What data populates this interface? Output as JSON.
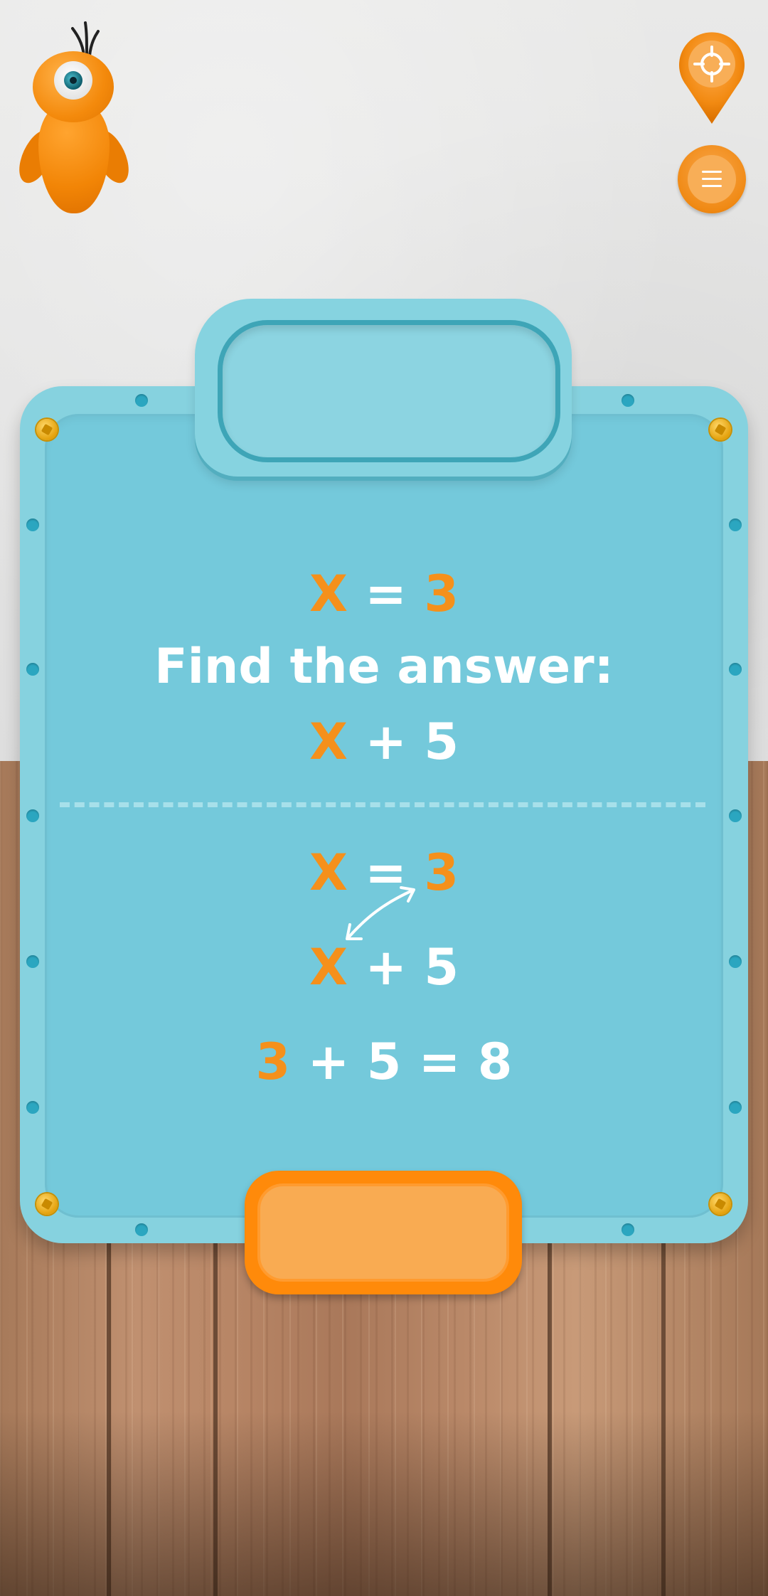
{
  "scene": {
    "mascot_icon": "orange-bird-mascot-icon",
    "locate_icon": "locate-crosshair-pin-icon",
    "menu_icon": "hamburger-menu-icon"
  },
  "board": {
    "given": {
      "var": "X",
      "eq": "=",
      "val": "3"
    },
    "prompt": "Find the answer:",
    "expression": {
      "var": "X",
      "rest": "+ 5"
    },
    "solution": {
      "given": {
        "var": "X",
        "eq": "=",
        "val": "3"
      },
      "expression": {
        "var": "X",
        "rest": "+ 5"
      },
      "result": {
        "val": "3",
        "rest": "+ 5 = 8"
      }
    }
  },
  "action_button": {
    "label": ""
  },
  "colors": {
    "accent": "#f5901b",
    "board": "#74c9db",
    "text": "#ffffff"
  }
}
